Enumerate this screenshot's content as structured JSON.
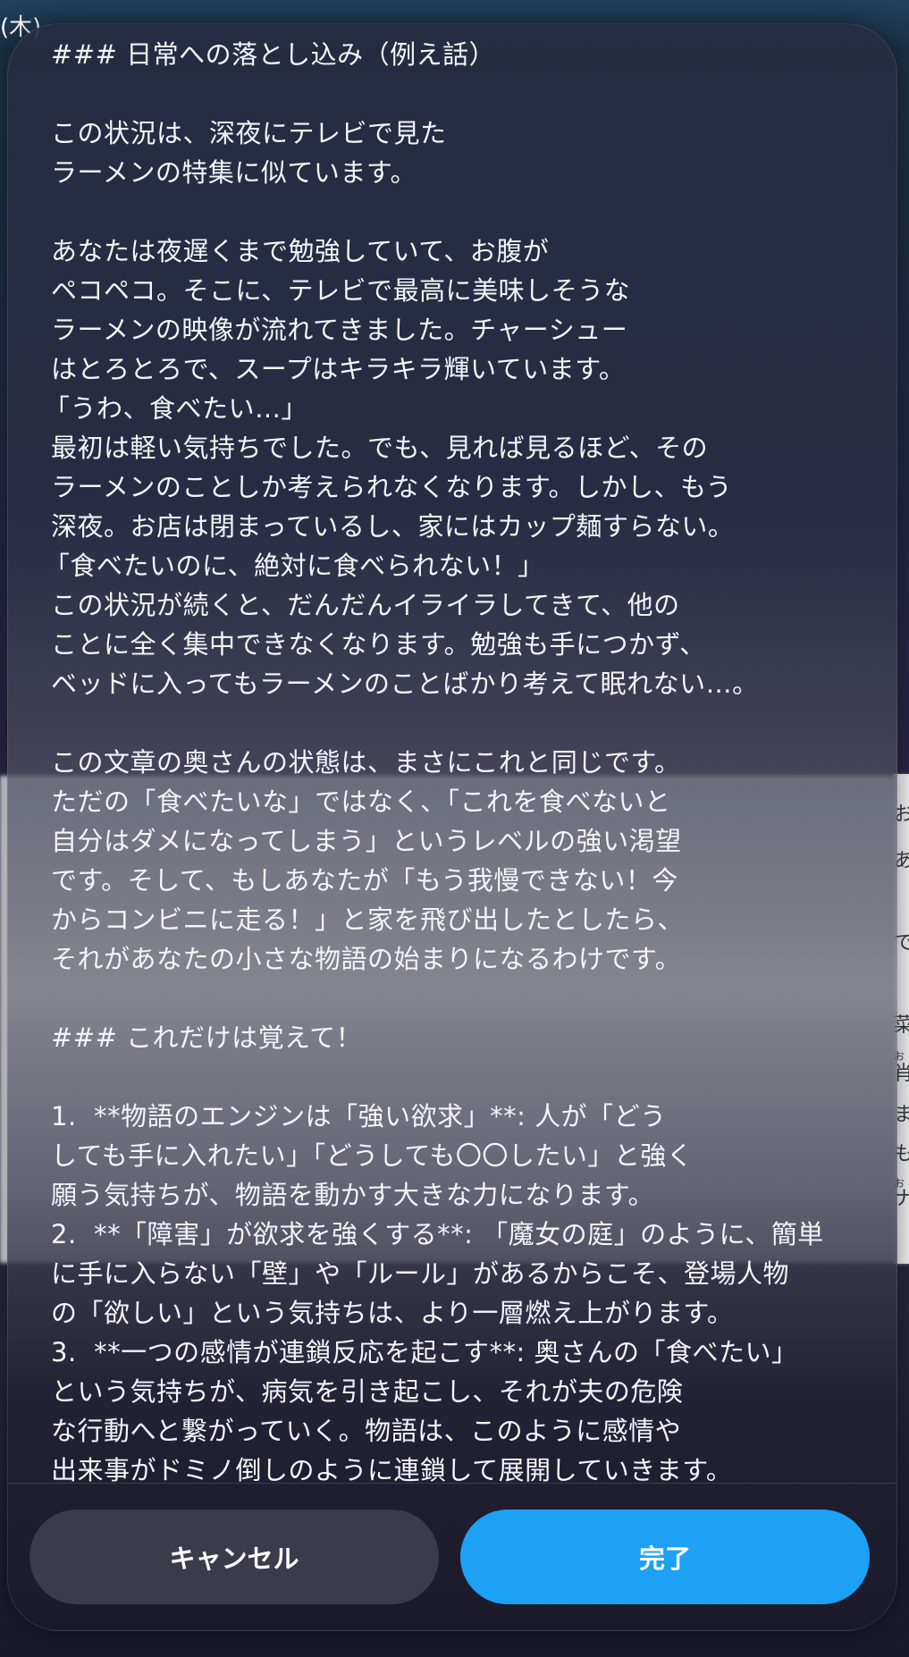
{
  "background": {
    "clock_text": "(木)",
    "glyphs": [
      "お",
      "あ",
      "で",
      "菜",
      "お",
      "肖",
      "ま",
      "も",
      "お",
      "ナ"
    ]
  },
  "dialog": {
    "lines": [
      "### 日常への落とし込み（例え話）",
      "",
      "この状況は、深夜にテレビで見た",
      "ラーメンの特集に似ています。",
      "",
      "あなたは夜遅くまで勉強していて、お腹が",
      "ペコペコ。そこに、テレビで最高に美味しそうな",
      "ラーメンの映像が流れてきました。チャーシュー",
      "はとろとろで、スープはキラキラ輝いています。",
      "「うわ、食べたい…」",
      "最初は軽い気持ちでした。でも、見れば見るほど、その",
      "ラーメンのことしか考えられなくなります。しかし、もう",
      "深夜。お店は閉まっているし、家にはカップ麺すらない。",
      "「食べたいのに、絶対に食べられない！」",
      "この状況が続くと、だんだんイライラしてきて、他の",
      "ことに全く集中できなくなります。勉強も手につかず、",
      "ベッドに入ってもラーメンのことばかり考えて眠れない…。",
      "",
      "この文章の奥さんの状態は、まさにこれと同じです。",
      "ただの「食べたいな」ではなく、「これを食べないと",
      "自分はダメになってしまう」というレベルの強い渇望",
      "です。そして、もしあなたが「もう我慢できない！今",
      "からコンビニに走る！」と家を飛び出したとしたら、",
      "それがあなたの小さな物語の始まりになるわけです。",
      "",
      "### これだけは覚えて！",
      "",
      "1.  **物語のエンジンは「強い欲求」**: 人が「どう",
      "しても手に入れたい」「どうしても〇〇したい」と強く",
      "願う気持ちが、物語を動かす大きな力になります。",
      "2.  **「障害」が欲求を強くする**: 「魔女の庭」のように、簡単",
      "に手に入らない「壁」や「ルール」があるからこそ、登場人物",
      "の「欲しい」という気持ちは、より一層燃え上がります。",
      "3.  **一つの感情が連鎖反応を起こす**: 奥さんの「食べたい」",
      "という気持ちが、病気を引き起こし、それが夫の危険",
      "な行動へと繋がっていく。物語は、このように感情や",
      "出来事がドミノ倒しのように連鎖して展開していきます。"
    ],
    "cancel_label": "キャンセル",
    "done_label": "完了"
  },
  "colors": {
    "accent": "#1ca1f5",
    "cancel_bg": "#3a3c4a",
    "text": "#f4f5f8"
  }
}
